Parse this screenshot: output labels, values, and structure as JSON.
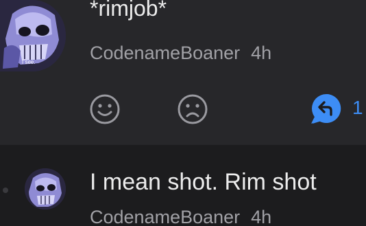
{
  "comment": {
    "text": "*rimjob*",
    "author": "CodenameBoaner",
    "time": "4h",
    "avatar_caption": "I see.",
    "avatar_icon": "skull-avatar-icon",
    "reply_count": "1"
  },
  "reply": {
    "text": "I mean shot. Rim shot",
    "author": "CodenameBoaner",
    "time": "4h",
    "avatar_icon": "skull-avatar-icon"
  },
  "colors": {
    "card_bg": "#27272a",
    "page_bg": "#1c1c1e",
    "accent": "#3d8df5",
    "text": "#ececec",
    "muted": "#a1a1a6"
  }
}
